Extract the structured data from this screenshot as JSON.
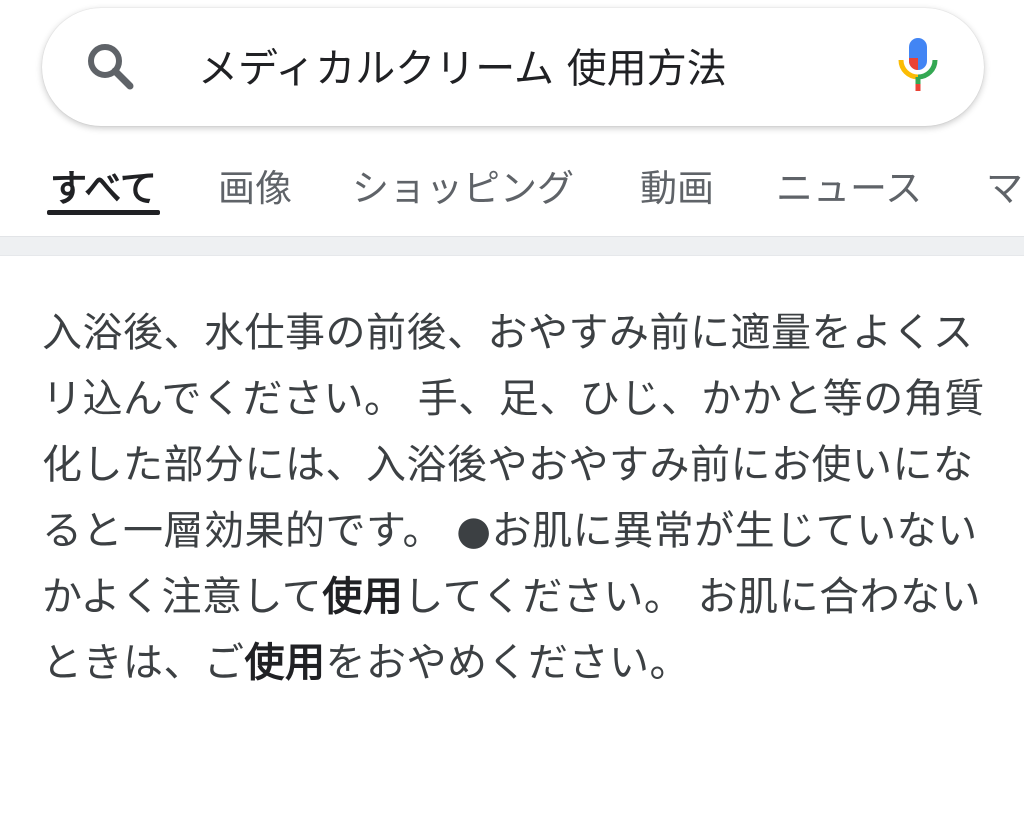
{
  "search": {
    "query": "メディカルクリーム 使用方法",
    "search_icon": "search-icon",
    "mic_icon": "mic-icon"
  },
  "tabs": [
    {
      "label": "すべて",
      "active": true
    },
    {
      "label": "画像",
      "active": false
    },
    {
      "label": "ショッピング",
      "active": false
    },
    {
      "label": "動画",
      "active": false
    },
    {
      "label": "ニュース",
      "active": false
    },
    {
      "label": "マ",
      "active": false
    }
  ],
  "snippet": {
    "part1": "入浴後、水仕事の前後、おやすみ前に適量をよくスリ込んでください。 手、足、ひじ、かかと等の角質化した部分には、入浴後やおやすみ前にお使いになると一層効果的です。 ●お肌に異常が生じていないかよく注意して",
    "bold1": "使用",
    "part2": "してください。 お肌に合わないときは、ご",
    "bold2": "使用",
    "part3": "をおやめください。"
  },
  "colors": {
    "text_primary": "#202124",
    "text_secondary": "#5f6368",
    "google_blue": "#4285F4",
    "google_red": "#EA4335",
    "google_yellow": "#FBBC04",
    "google_green": "#34A853"
  }
}
